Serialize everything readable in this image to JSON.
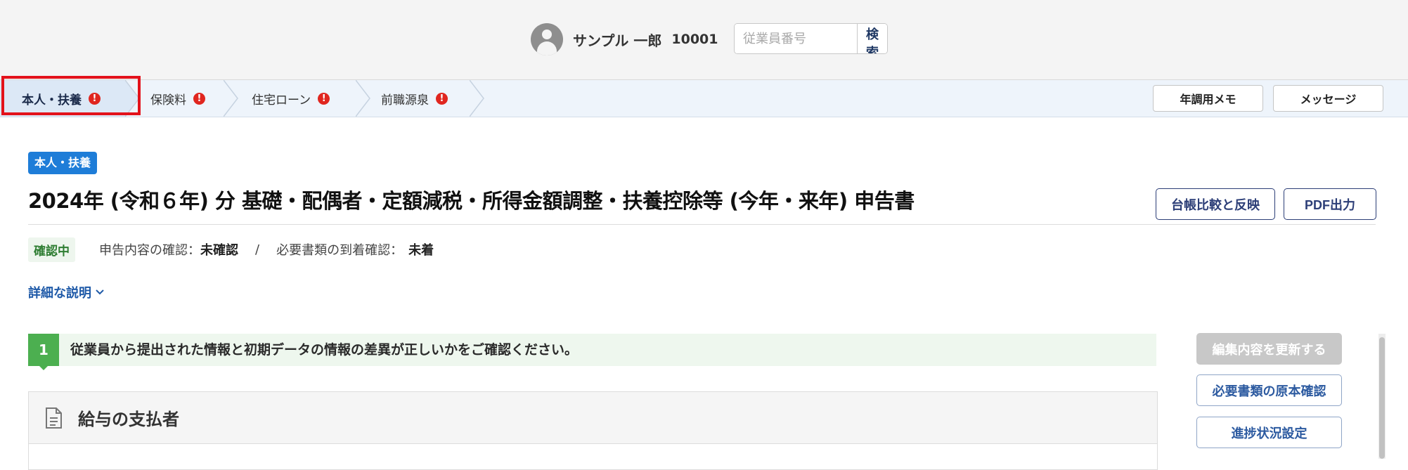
{
  "header": {
    "employee_name": "サンプル 一郎",
    "employee_number": "10001",
    "search": {
      "placeholder": "従業員番号",
      "button_label": "検索"
    }
  },
  "tabs": [
    {
      "label": "本人・扶養",
      "active": true,
      "warning": "!"
    },
    {
      "label": "保険料",
      "active": false,
      "warning": "!"
    },
    {
      "label": "住宅ローン",
      "active": false,
      "warning": "!"
    },
    {
      "label": "前職源泉",
      "active": false,
      "warning": "!"
    }
  ],
  "toolbar": {
    "memo_label": "年調用メモ",
    "message_label": "メッセージ"
  },
  "page": {
    "category_badge": "本人・扶養",
    "title": "2024年 (令和６年) 分 基礎・配偶者・定額減税・所得金額調整・扶養控除等 (今年・来年) 申告書",
    "compare_button": "台帳比較と反映",
    "pdf_button": "PDF出力",
    "status_badge": "確認中",
    "review_label": "申告内容の確認：",
    "review_value": "未確認",
    "separator": "/",
    "arrival_label": "必要書類の到着確認：",
    "arrival_value": "未着",
    "detail_link": "詳細な説明",
    "step_number": "1",
    "step_text": "従業員から提出された情報と初期データの情報の差異が正しいかをご確認ください。",
    "section_title": "給与の支払者"
  },
  "side_actions": {
    "update_label": "編集内容を更新する",
    "original_check_label": "必要書類の原本確認",
    "progress_label": "進捗状況設定"
  },
  "colors": {
    "active_tab_outline": "#e3121b",
    "badge_blue": "#1e7dd8",
    "step_green": "#4caf50",
    "warning_red": "#e0261f"
  },
  "icons": [
    "user-avatar-icon",
    "warning-icon",
    "chevron-down-icon",
    "document-icon"
  ]
}
